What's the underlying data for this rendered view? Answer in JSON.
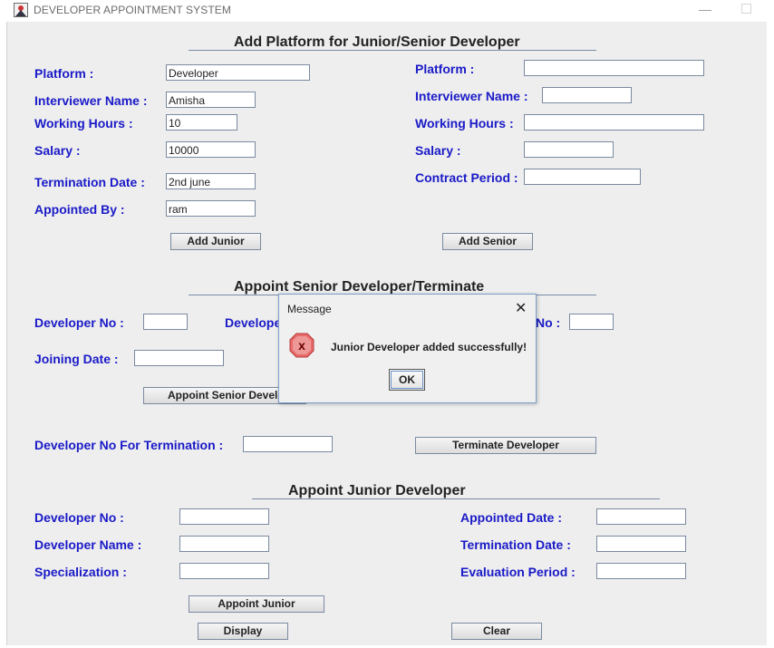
{
  "window": {
    "title": "DEVELOPER APPOINTMENT SYSTEM",
    "minimize_glyph": "—"
  },
  "platform_section": {
    "heading": "Add Platform for Junior/Senior Developer",
    "junior": {
      "platform_label": "Platform :",
      "platform_value": "Developer",
      "interviewer_label": "Interviewer Name :",
      "interviewer_value": "Amisha",
      "hours_label": "Working Hours :",
      "hours_value": "10",
      "salary_label": "Salary :",
      "salary_value": "10000",
      "termination_label": "Termination Date :",
      "termination_value": "2nd june",
      "appointed_by_label": "Appointed By :",
      "appointed_by_value": "ram",
      "add_button": "Add Junior"
    },
    "senior": {
      "platform_label": "Platform :",
      "platform_value": "",
      "interviewer_label": "Interviewer Name :",
      "interviewer_value": "",
      "hours_label": "Working Hours :",
      "hours_value": "",
      "salary_label": "Salary :",
      "salary_value": "",
      "contract_label": "Contract Period :",
      "contract_value": "",
      "add_button": "Add Senior"
    }
  },
  "senior_section": {
    "heading": "Appoint Senior Developer/Terminate",
    "dev_no_label": "Developer No :",
    "dev_no_value": "",
    "dev_name_label_partial": "Develope",
    "right_label_partial": "No :",
    "right_value": "",
    "joining_label": "Joining Date :",
    "joining_value": "",
    "appoint_button_partial": "Appoint Senior Develo",
    "termination_no_label": "Developer No For Termination :",
    "termination_no_value": "",
    "terminate_button": "Terminate Developer"
  },
  "junior_section": {
    "heading": "Appoint Junior Developer",
    "dev_no_label": "Developer No :",
    "dev_no_value": "",
    "dev_name_label": "Developer Name :",
    "dev_name_value": "",
    "specialization_label": "Specialization :",
    "specialization_value": "",
    "appointed_date_label": "Appointed Date :",
    "appointed_date_value": "",
    "termination_date_label": "Termination Date :",
    "termination_date_value": "",
    "evaluation_label": "Evaluation Period :",
    "evaluation_value": "",
    "appoint_button": "Appoint Junior",
    "display_button": "Display",
    "clear_button": "Clear"
  },
  "dialog": {
    "title": "Message",
    "close_glyph": "✕",
    "icon_glyph": "x",
    "message": "Junior Developer added successfully!",
    "ok_button": "OK"
  }
}
